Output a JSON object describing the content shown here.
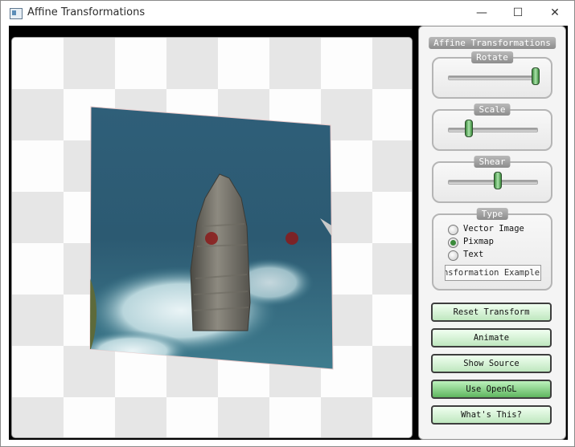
{
  "window": {
    "title": "Affine Transformations",
    "minimize": "—",
    "maximize": "☐",
    "close": "✕"
  },
  "panel": {
    "title": "Affine Transformations",
    "rotate": {
      "title": "Rotate",
      "value": 1.0
    },
    "scale": {
      "title": "Scale",
      "value": 0.2
    },
    "shear": {
      "title": "Shear",
      "value": 0.55
    },
    "type": {
      "title": "Type",
      "options": [
        {
          "label": "Vector Image",
          "checked": false
        },
        {
          "label": "Pixmap",
          "checked": true
        },
        {
          "label": "Text",
          "checked": false
        }
      ],
      "text_value": "Transformation Example"
    },
    "buttons": {
      "reset": "Reset Transform",
      "animate": "Animate",
      "show_source": "Show Source",
      "use_opengl": "Use OpenGL",
      "whats_this": "What's This?"
    }
  },
  "colors": {
    "accent_green": "#3a8a3a",
    "control_point": "#8b1a1a"
  }
}
